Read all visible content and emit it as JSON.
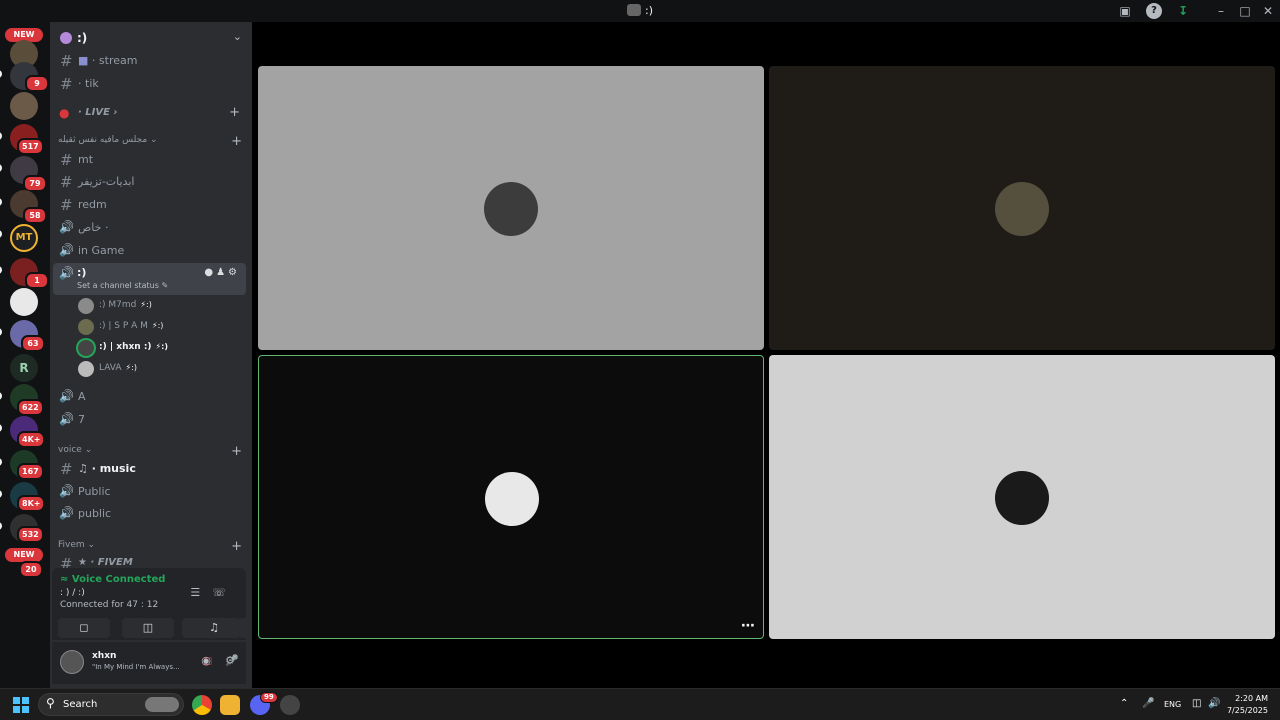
{
  "window": {
    "title": ":)"
  },
  "rail": {
    "new_label": "NEW",
    "badges": [
      "9",
      "517",
      "79",
      "58",
      "1",
      "63",
      "622",
      "4K+",
      "167",
      "8K+",
      "532",
      "20"
    ],
    "server_initials": {
      "mt": "MT",
      "r": "R"
    }
  },
  "server": {
    "name": ":)",
    "header_icon": "chevron-down-icon"
  },
  "channels": {
    "stream": "stream",
    "tik": "tik",
    "live": "LIVE",
    "cat1": "مجلس مافيه نفس ثقيله",
    "mt": "mt",
    "clips": "ابديات-تزيفر",
    "redm": "redm",
    "private": "خاص",
    "in_game": "in Game",
    "active_name": ":)",
    "active_status": "Set a channel status",
    "voice_users": [
      {
        "name": ":) M7md",
        "tag": ":)"
      },
      {
        "name": ":) | S P A M",
        "tag": ":)"
      },
      {
        "name": ":) | xhxn :)",
        "tag": ":)"
      },
      {
        "name": "LAVA",
        "tag": ":)"
      }
    ],
    "a": "A",
    "seven": "7",
    "cat_voice": "voice",
    "music": "music",
    "public1": "Public",
    "public2": "public",
    "cat_fivem": "Fivem",
    "fivem": "FIVEM"
  },
  "voice_panel": {
    "status": "Voice Connected",
    "channel": ": ) / :)",
    "connected_for": "Connected for 47 : 12"
  },
  "user_panel": {
    "username": "xhxn",
    "status": "\"In My Mind I'm Always..."
  },
  "taskbar": {
    "search_label": "Search",
    "discord_badge": "99",
    "lang": "ENG",
    "time": "2:20 AM",
    "date": "7/25/2025"
  },
  "colors": {
    "speaking_border": "#23a55a",
    "badge_red": "#da373c",
    "sidebar_bg": "#2b2d31",
    "rail_bg": "#111214"
  }
}
